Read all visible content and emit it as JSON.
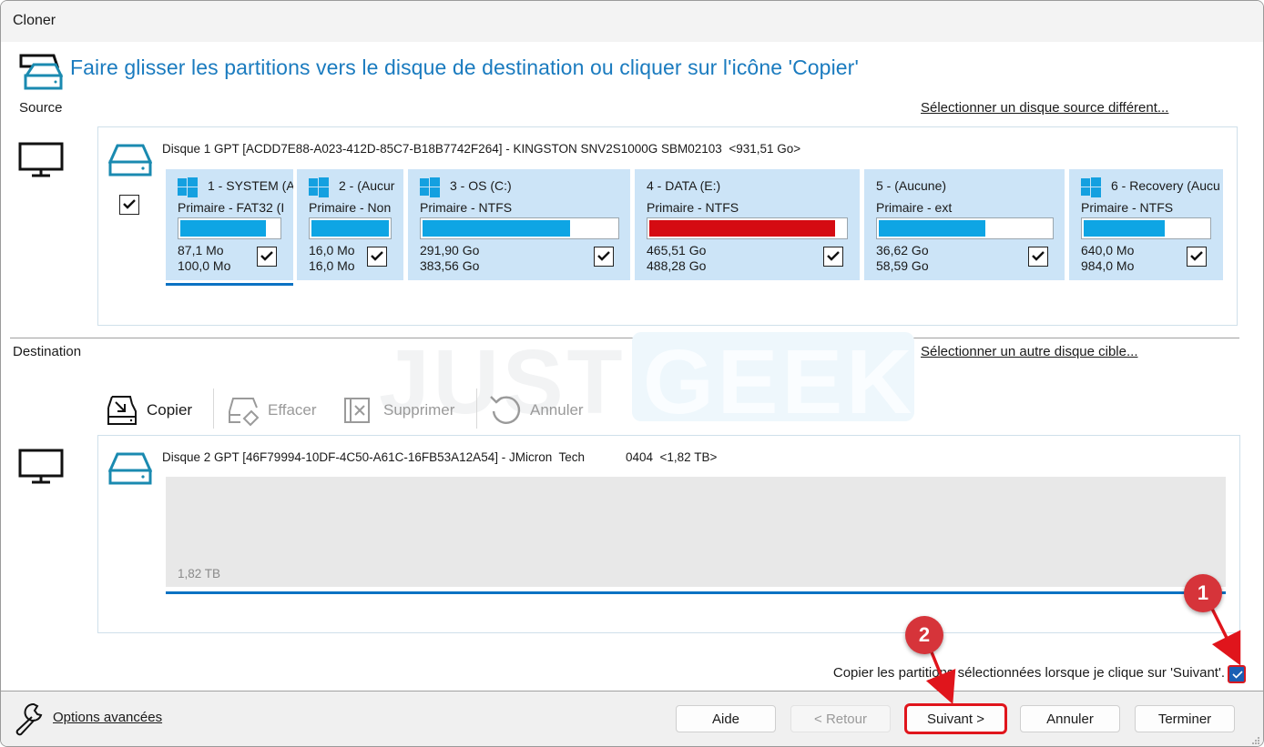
{
  "window": {
    "title": "Cloner"
  },
  "header": {
    "instruction": "Faire glisser les partitions vers le disque de destination ou cliquer sur l'icône  'Copier'"
  },
  "source": {
    "label": "Source",
    "select_link": "Sélectionner un disque source différent...",
    "disk_label": "Disque 1 GPT [ACDD7E88-A023-412D-85C7-B18B7742F264] - KINGSTON SNV2S1000G SBM02103  <931,51 Go>",
    "disk_checked": true,
    "partitions": [
      {
        "title": "1 - SYSTEM (A",
        "type": "Primaire - FAT32 (I",
        "used": "87,1 Mo",
        "total": "100,0 Mo",
        "fill_percent": 87,
        "windows_logo": true,
        "checked": true,
        "bar_color": "#0ea5e4",
        "selected": true
      },
      {
        "title": "2 -  (Aucur",
        "type": "Primaire - Non",
        "used": "16,0 Mo",
        "total": "16,0 Mo",
        "fill_percent": 100,
        "windows_logo": true,
        "checked": true,
        "bar_color": "#0ea5e4",
        "selected": false
      },
      {
        "title": "3 - OS (C:)",
        "type": "Primaire - NTFS",
        "used": "291,90 Go",
        "total": "383,56 Go",
        "fill_percent": 76,
        "windows_logo": true,
        "checked": true,
        "bar_color": "#0ea5e4",
        "selected": false
      },
      {
        "title": "4 - DATA (E:)",
        "type": "Primaire - NTFS",
        "used": "465,51 Go",
        "total": "488,28 Go",
        "fill_percent": 95,
        "windows_logo": false,
        "checked": true,
        "bar_color": "#d50b12",
        "selected": false
      },
      {
        "title": "5 -  (Aucune)",
        "type": "Primaire - ext",
        "used": "36,62 Go",
        "total": "58,59 Go",
        "fill_percent": 62,
        "windows_logo": false,
        "checked": true,
        "bar_color": "#0ea5e4",
        "selected": false
      },
      {
        "title": "6 - Recovery (Aucu",
        "type": "Primaire - NTFS",
        "used": "640,0 Mo",
        "total": "984,0 Mo",
        "fill_percent": 65,
        "windows_logo": true,
        "checked": true,
        "bar_color": "#0ea5e4",
        "selected": false
      }
    ]
  },
  "destination": {
    "label": "Destination",
    "select_link": "Sélectionner un autre disque cible...",
    "toolbar": [
      {
        "label": "Copier",
        "icon": "copy-disk-icon",
        "enabled": true
      },
      {
        "label": "Effacer",
        "icon": "erase-icon",
        "enabled": false
      },
      {
        "label": "Supprimer",
        "icon": "delete-icon",
        "enabled": false
      },
      {
        "label": "Annuler",
        "icon": "undo-icon",
        "enabled": false
      }
    ],
    "disk_label": "Disque 2 GPT [46F79994-10DF-4C50-A61C-16FB53A12A54] - JMicron  Tech            0404  <1,82 TB>",
    "unallocated_size": "1,82 TB"
  },
  "watermark": {
    "part1": "JUST",
    "part2": "GEEK"
  },
  "copy_option": {
    "label": "Copier les partitions sélectionnées lorsque je clique sur 'Suivant'.",
    "checked": true
  },
  "footer": {
    "advanced_options": "Options avancées",
    "buttons": {
      "help": "Aide",
      "back": "< Retour",
      "next": "Suivant >",
      "cancel": "Annuler",
      "finish": "Terminer"
    }
  },
  "annotations": [
    {
      "number": "1"
    },
    {
      "number": "2"
    }
  ],
  "colors": {
    "accent": "#1a7bbf",
    "partition_bg": "#cce4f7",
    "bar_blue": "#0ea5e4",
    "bar_red": "#d50b12",
    "annotation_red": "#d6343a"
  }
}
